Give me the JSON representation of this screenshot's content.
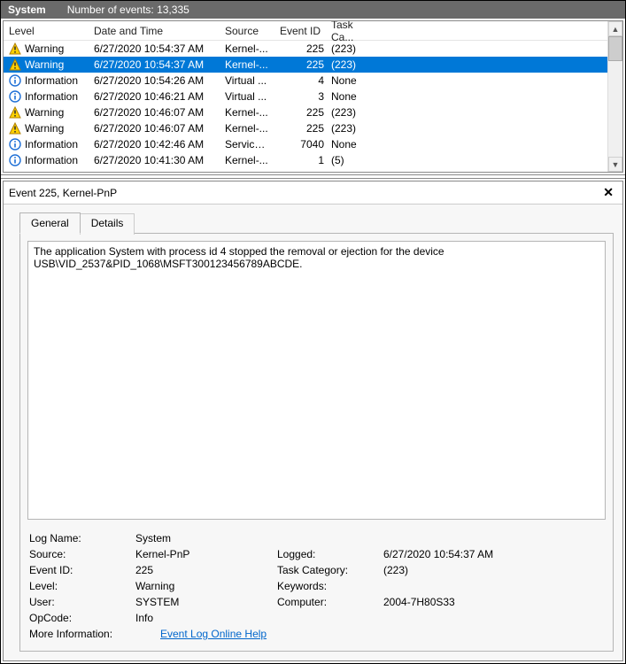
{
  "header": {
    "title": "System",
    "count_label": "Number of events: 13,335"
  },
  "columns": {
    "level": "Level",
    "date": "Date and Time",
    "source": "Source",
    "event_id": "Event ID",
    "task": "Task Ca..."
  },
  "rows": [
    {
      "kind": "warning",
      "level": "Warning",
      "date": "6/27/2020 10:54:37 AM",
      "source": "Kernel-...",
      "event_id": "225",
      "task": "(223)",
      "selected": false
    },
    {
      "kind": "warning",
      "level": "Warning",
      "date": "6/27/2020 10:54:37 AM",
      "source": "Kernel-...",
      "event_id": "225",
      "task": "(223)",
      "selected": true
    },
    {
      "kind": "info",
      "level": "Information",
      "date": "6/27/2020 10:54:26 AM",
      "source": "Virtual ...",
      "event_id": "4",
      "task": "None",
      "selected": false
    },
    {
      "kind": "info",
      "level": "Information",
      "date": "6/27/2020 10:46:21 AM",
      "source": "Virtual ...",
      "event_id": "3",
      "task": "None",
      "selected": false
    },
    {
      "kind": "warning",
      "level": "Warning",
      "date": "6/27/2020 10:46:07 AM",
      "source": "Kernel-...",
      "event_id": "225",
      "task": "(223)",
      "selected": false
    },
    {
      "kind": "warning",
      "level": "Warning",
      "date": "6/27/2020 10:46:07 AM",
      "source": "Kernel-...",
      "event_id": "225",
      "task": "(223)",
      "selected": false
    },
    {
      "kind": "info",
      "level": "Information",
      "date": "6/27/2020 10:42:46 AM",
      "source": "Service ...",
      "event_id": "7040",
      "task": "None",
      "selected": false
    },
    {
      "kind": "info",
      "level": "Information",
      "date": "6/27/2020 10:41:30 AM",
      "source": "Kernel-...",
      "event_id": "1",
      "task": "(5)",
      "selected": false
    }
  ],
  "detail": {
    "title": "Event 225, Kernel-PnP",
    "tabs": {
      "general": "General",
      "details": "Details"
    },
    "message": "The application System with process id 4 stopped the removal or ejection for the device USB\\VID_2537&PID_1068\\MSFT300123456789ABCDE.",
    "props": {
      "log_name_label": "Log Name:",
      "log_name": "System",
      "source_label": "Source:",
      "source": "Kernel-PnP",
      "logged_label": "Logged:",
      "logged": "6/27/2020 10:54:37 AM",
      "event_id_label": "Event ID:",
      "event_id": "225",
      "task_cat_label": "Task Category:",
      "task_cat": "(223)",
      "level_label": "Level:",
      "level": "Warning",
      "keywords_label": "Keywords:",
      "keywords": "",
      "user_label": "User:",
      "user": "SYSTEM",
      "computer_label": "Computer:",
      "computer": "2004-7H80S33",
      "opcode_label": "OpCode:",
      "opcode": "Info",
      "more_info_label": "More Information:",
      "more_info_link": "Event Log Online Help"
    }
  }
}
